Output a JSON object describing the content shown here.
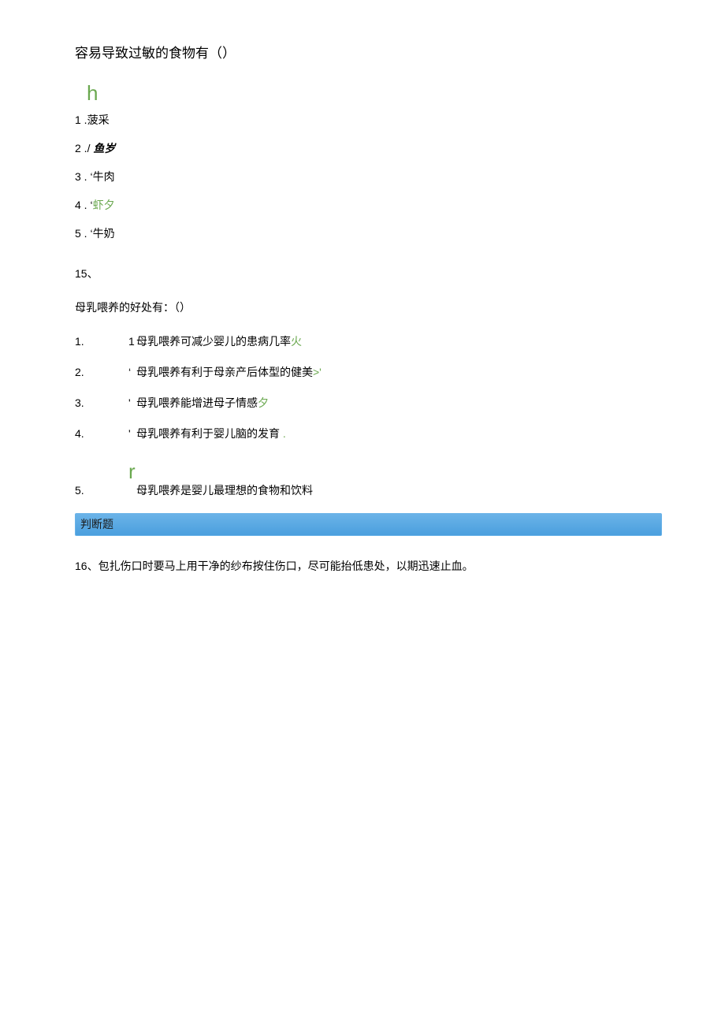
{
  "q14": {
    "title": "容易导致过敏的食物有（）",
    "artifact_h": "h",
    "options": [
      {
        "num": "1",
        "sep": " .",
        "pre": "",
        "text": "菠采",
        "marked": "",
        "cls": ""
      },
      {
        "num": "2",
        "sep": " .",
        "pre": "/ ",
        "text": "鱼岁",
        "marked": "",
        "cls": "italicish"
      },
      {
        "num": "3",
        "sep": " .",
        "pre": " ‘",
        "text": "牛肉",
        "marked": "",
        "cls": ""
      },
      {
        "num": "4",
        "sep": " .",
        "pre": " ‘",
        "text": "虾",
        "marked": "夕",
        "cls": ""
      },
      {
        "num": "5",
        "sep": " .",
        "pre": " ‘",
        "text": "牛奶",
        "marked": "",
        "cls": ""
      }
    ]
  },
  "q15": {
    "number": "15、",
    "title": "母乳喂养的好处有：（）",
    "options": [
      {
        "num": "1.",
        "pre": "1 ",
        "text": "母乳喂养可减少婴儿的患病几率",
        "marked": "火"
      },
      {
        "num": "2.",
        "pre": "‘",
        "text": "母乳喂养有利于母亲产后体型的健美",
        "marked": ">'"
      },
      {
        "num": "3.",
        "pre": "' ",
        "text": "母乳喂养能增进母子情感",
        "marked": "夕"
      },
      {
        "num": "4.",
        "pre": "' ",
        "text": "母乳喂养有利于婴儿脑的发育",
        "marked": "  ."
      },
      {
        "num": "5.",
        "pre": "",
        "text": "母乳喂养是婴儿最理想的食物和饮料",
        "marked": ""
      }
    ],
    "artifact_r": "r"
  },
  "section_bar": "判断题",
  "q16": {
    "text": "16、包扎伤口时要马上用干净的纱布按住伤口，尽可能抬低患处，以期迅速止血。"
  }
}
